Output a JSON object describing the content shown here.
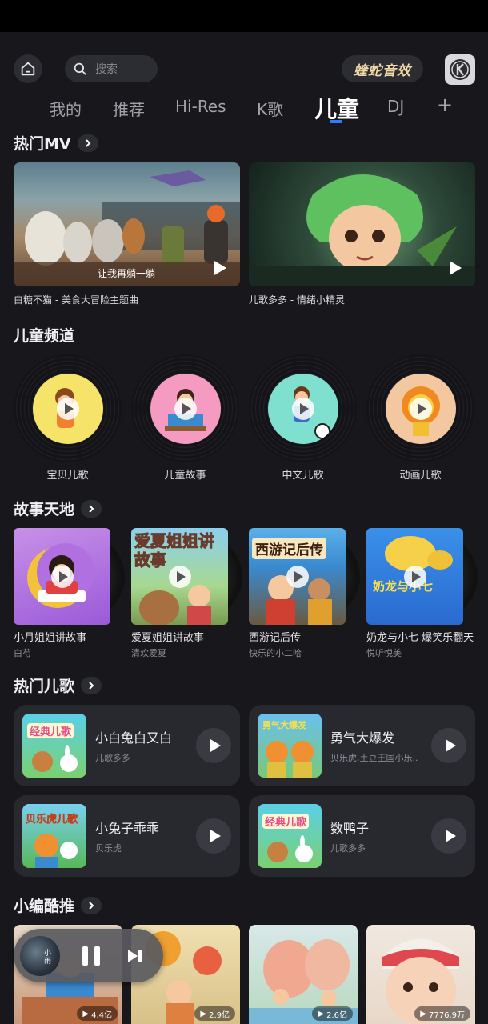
{
  "search": {
    "placeholder": "搜索"
  },
  "brand": {
    "label": "蝰蛇音效"
  },
  "tabs": [
    {
      "label": "我的"
    },
    {
      "label": "推荐"
    },
    {
      "label": "Hi-Res"
    },
    {
      "label": "K歌"
    },
    {
      "label": "儿童",
      "active": true
    },
    {
      "label": "DJ"
    },
    {
      "label": "+"
    }
  ],
  "mv_section": {
    "title": "热门MV",
    "items": [
      {
        "caption": "白糖不猫 - 美食大冒险主题曲",
        "overlay": "让我再躺一躺"
      },
      {
        "caption": "儿歌多多 - 情绪小精灵"
      }
    ]
  },
  "channel_section": {
    "title": "儿童频道",
    "items": [
      {
        "label": "宝贝儿歌",
        "color": "#f6e46a"
      },
      {
        "label": "儿童故事",
        "color": "#f59ac0"
      },
      {
        "label": "中文儿歌",
        "color": "#7fe0d0"
      },
      {
        "label": "动画儿歌",
        "color": "#f3c7a0"
      }
    ]
  },
  "story_section": {
    "title": "故事天地",
    "items": [
      {
        "title": "小月姐姐讲故事",
        "sub": "白芍"
      },
      {
        "title": "爱夏姐姐讲故事",
        "sub": "清欢爱夏",
        "art_text": "爱夏姐姐讲故事"
      },
      {
        "title": "西游记后传",
        "sub": "快乐的小二哈",
        "art_text": "西游记后传"
      },
      {
        "title": "奶龙与小七 爆笑乐翻天",
        "sub": "悦听悦美",
        "art_text": "奶龙与小七"
      }
    ]
  },
  "song_section": {
    "title": "热门儿歌",
    "items": [
      {
        "name": "小白兔白又白",
        "artist": "儿歌多多",
        "art_text": "经典儿歌"
      },
      {
        "name": "勇气大爆发",
        "artist": "贝乐虎,土豆王国小乐...",
        "art_text": "勇气大爆发"
      },
      {
        "name": "小兔子乖乖",
        "artist": "贝乐虎",
        "art_text": "贝乐虎儿歌"
      },
      {
        "name": "数鸭子",
        "artist": "儿歌多多",
        "art_text": "经典儿歌"
      }
    ]
  },
  "picks_section": {
    "title": "小编酷推",
    "items": [
      {
        "count": "4.4亿"
      },
      {
        "count": "2.9亿"
      },
      {
        "count": "2.6亿"
      },
      {
        "count": "7776.9万"
      }
    ]
  },
  "mini_player": {
    "cover_text": "小雨"
  },
  "colors": {
    "accent": "#2f7bff",
    "background": "#17171c",
    "card": "#28282f"
  }
}
